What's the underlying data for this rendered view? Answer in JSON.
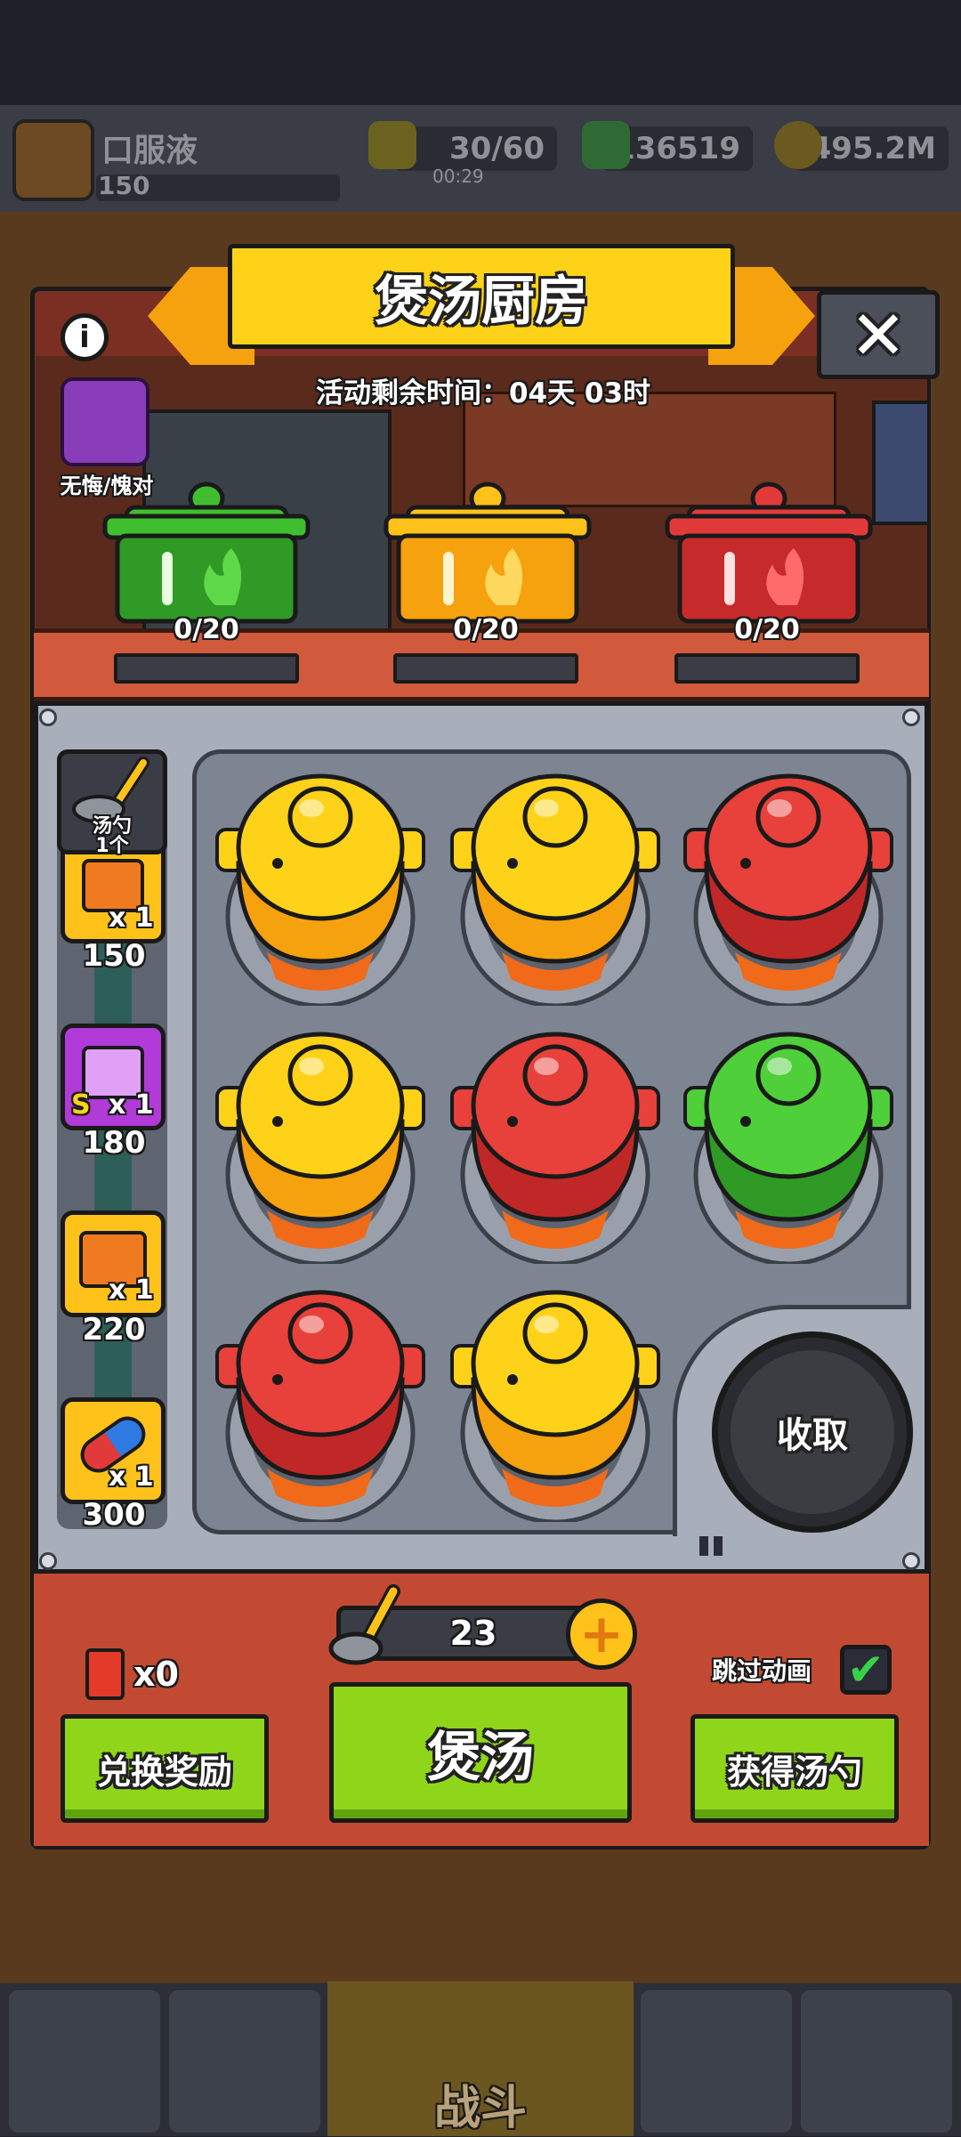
{
  "player": {
    "name": "口服液",
    "level": "150"
  },
  "resources": {
    "energy": "30/60",
    "energy_timer": "00:29",
    "gems": "136519",
    "coins": "495.2M"
  },
  "event": {
    "title": "煲汤厨房",
    "timer_label": "活动剩余时间：04天 03时",
    "avatar_label": "无悔/愧对",
    "pots": [
      {
        "color": "green",
        "hex": "#3fbf2f",
        "progress": "0/20"
      },
      {
        "color": "yellow",
        "hex": "#ffc21a",
        "progress": "0/20"
      },
      {
        "color": "red",
        "hex": "#e23a3a",
        "progress": "0/20"
      }
    ]
  },
  "ladle_card": {
    "line1": "汤勺",
    "line2": "1个"
  },
  "rewards": [
    {
      "qty": "x 1",
      "value": "150",
      "icon": "robot-chest-icon"
    },
    {
      "qty": "x 1",
      "value": "180",
      "icon": "purple-chest-icon",
      "badge": "S"
    },
    {
      "qty": "x 1",
      "value": "220",
      "icon": "orange-chest-icon"
    },
    {
      "qty": "x 1",
      "value": "300",
      "icon": "capsule-icon"
    }
  ],
  "board": {
    "pots": [
      "yellow",
      "yellow",
      "red",
      "yellow",
      "red",
      "green",
      "red",
      "yellow"
    ],
    "collect_label": "收取"
  },
  "footer": {
    "cards": "x0",
    "ladles": "23",
    "exchange_label": "兑换奖励",
    "stew_label": "煲汤",
    "get_ladle_label": "获得汤勺",
    "skip_label": "跳过动画",
    "skip_checked": "✔"
  },
  "nav": {
    "center_label": "战斗"
  },
  "colors": {
    "yellow": "#ffc21a",
    "red": "#e23a3a",
    "green": "#3fbf2f",
    "button_green": "#8fd61a"
  }
}
